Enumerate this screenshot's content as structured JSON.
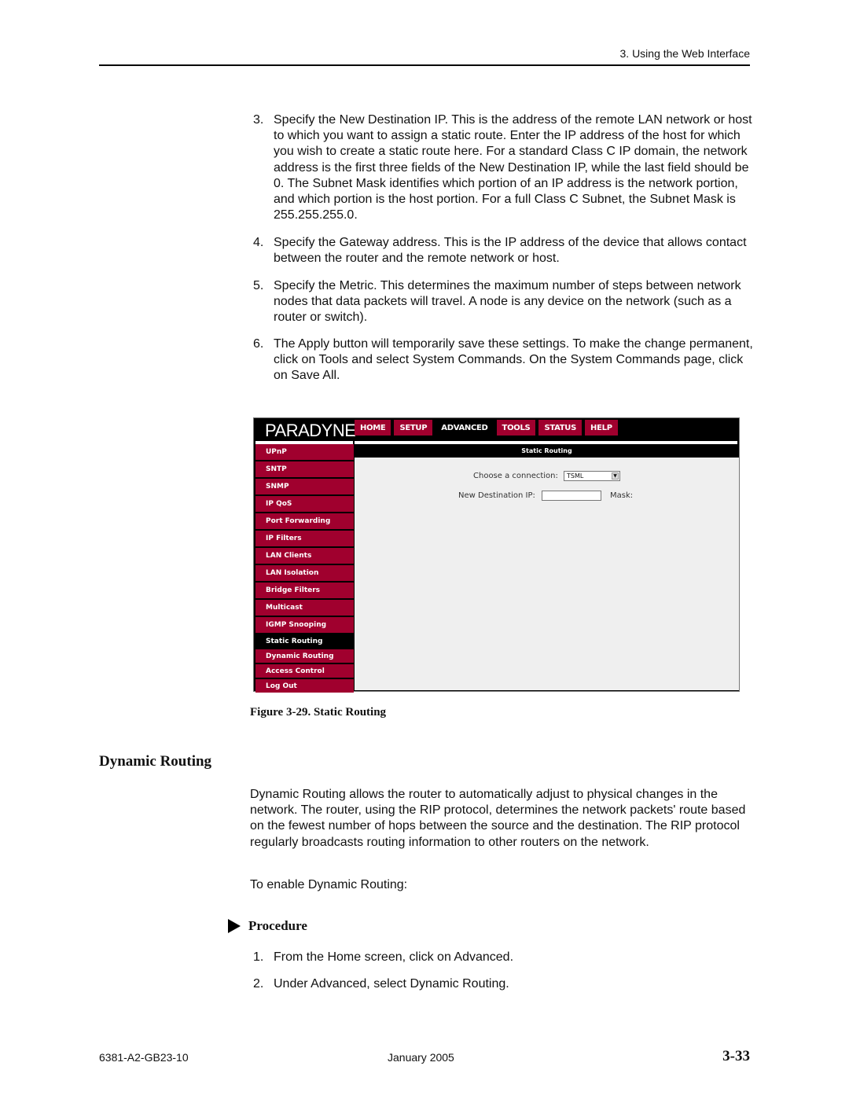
{
  "header": {
    "section": "3. Using the Web Interface"
  },
  "steps_top": [
    {
      "num": "3.",
      "text": "Specify the New Destination IP. This is the address of the remote LAN network or host to which you want to assign a static route. Enter the IP address of the host for which you wish to create a static route here. For a standard Class C IP domain, the network address is the first three fields of the New Destination IP, while the last field should be 0. The Subnet Mask identifies which portion of an IP address is the network portion, and which portion is the host portion. For a full Class C Subnet, the Subnet Mask is 255.255.255.0."
    },
    {
      "num": "4.",
      "text": "Specify the Gateway address. This is the IP address of the device that allows contact between the router and the remote network or host."
    },
    {
      "num": "5.",
      "text": "Specify the Metric. This determines the maximum number of steps between network nodes that data packets will travel. A node is any device on the network (such as a router or switch)."
    },
    {
      "num": "6.",
      "text": "The Apply button will temporarily save these settings. To make the change permanent, click on Tools and select System Commands. On the System Commands page, click on Save All."
    }
  ],
  "screenshot": {
    "logo": "PARADYNE",
    "nav": [
      "HOME",
      "SETUP",
      "ADVANCED",
      "TOOLS",
      "STATUS",
      "HELP"
    ],
    "nav_active": "ADVANCED",
    "sidebar": [
      "UPnP",
      "SNTP",
      "SNMP",
      "IP QoS",
      "Port Forwarding",
      "IP Filters",
      "LAN Clients",
      "LAN Isolation",
      "Bridge Filters",
      "Multicast",
      "IGMP Snooping",
      "Static Routing",
      "Dynamic Routing",
      "Access Control",
      "Log Out"
    ],
    "sidebar_active": "Static Routing",
    "content_title": "Static Routing",
    "connection_label": "Choose a connection:",
    "connection_value": "TSML",
    "dest_ip_label": "New Destination IP:",
    "dest_ip_value": "",
    "mask_label": "Mask:",
    "colors": {
      "brand": "#a0002e",
      "bar": "#000000",
      "content_bg": "#efefef"
    }
  },
  "figure_caption": "Figure 3-29.   Static Routing",
  "section_heading": "Dynamic Routing",
  "intro_paragraph": "Dynamic Routing allows the router to automatically adjust to physical changes in the network. The router, using the RIP protocol, determines the network packets' route based on the fewest number of hops between the source and the destination. The RIP protocol regularly broadcasts routing information to other routers on the network.",
  "enable_text": "To enable Dynamic Routing:",
  "procedure_label": "Procedure",
  "procedure_steps": [
    {
      "num": "1.",
      "text": "From the Home screen, click on Advanced."
    },
    {
      "num": "2.",
      "text": "Under Advanced, select Dynamic Routing."
    }
  ],
  "footer": {
    "doc_number": "6381-A2-GB23-10",
    "date": "January 2005",
    "page": "3-33"
  }
}
